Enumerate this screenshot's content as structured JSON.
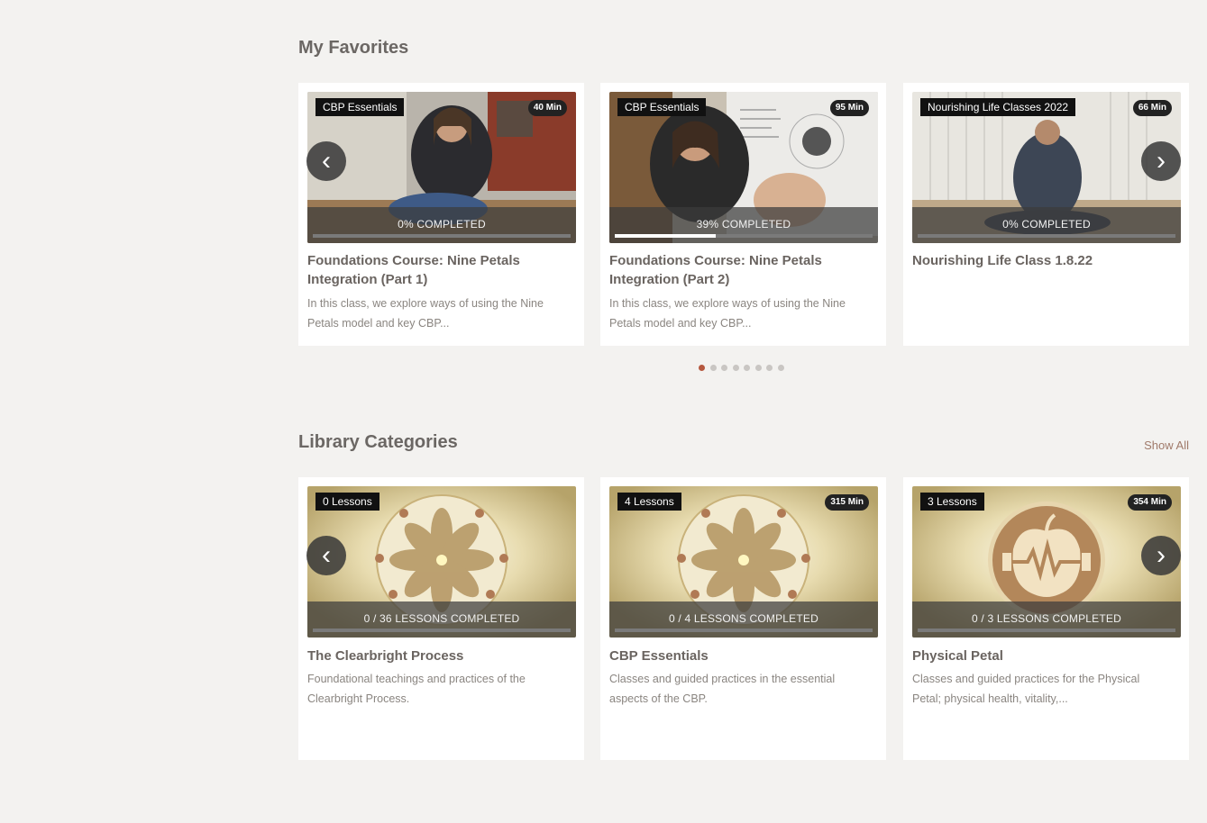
{
  "favorites": {
    "title": "My Favorites",
    "cards": [
      {
        "tag": "CBP Essentials",
        "duration": "40 Min",
        "progress_label": "0% COMPLETED",
        "progress": 0,
        "title": "Foundations Course: Nine Petals Integration (Part 1)",
        "description": "In this class, we explore ways of using the Nine Petals model and key CBP..."
      },
      {
        "tag": "CBP Essentials",
        "duration": "95 Min",
        "progress_label": "39% COMPLETED",
        "progress": 0.39,
        "title": "Foundations Course: Nine Petals Integration (Part 2)",
        "description": "In this class, we explore ways of using the Nine Petals model and key CBP..."
      },
      {
        "tag": "Nourishing Life Classes 2022",
        "duration": "66 Min",
        "progress_label": "0% COMPLETED",
        "progress": 0,
        "title": "Nourishing Life Class 1.8.22",
        "description": ""
      }
    ],
    "pagination": {
      "count": 8,
      "active": 0
    }
  },
  "library": {
    "title": "Library Categories",
    "show_all": "Show All",
    "cards": [
      {
        "tag": "0 Lessons",
        "duration": "",
        "progress_label": "0 / 36  LESSONS COMPLETED",
        "progress": 0,
        "title": "The Clearbright Process",
        "description": "Foundational teachings and practices of the Clearbright Process."
      },
      {
        "tag": "4 Lessons",
        "duration": "315 Min",
        "progress_label": "0 / 4  LESSONS COMPLETED",
        "progress": 0,
        "title": "CBP Essentials",
        "description": "Classes and guided practices in the essential aspects of the CBP."
      },
      {
        "tag": "3 Lessons",
        "duration": "354 Min",
        "progress_label": "0 / 3  LESSONS COMPLETED",
        "progress": 0,
        "title": "Physical Petal",
        "description": "Classes and guided practices for the Physical Petal; physical health, vitality,..."
      }
    ]
  },
  "arrows": {
    "prev": "‹",
    "next": "›"
  },
  "colors": {
    "background": "#f3f2f0",
    "accent": "#b5583f",
    "title_text": "#6b6764"
  }
}
